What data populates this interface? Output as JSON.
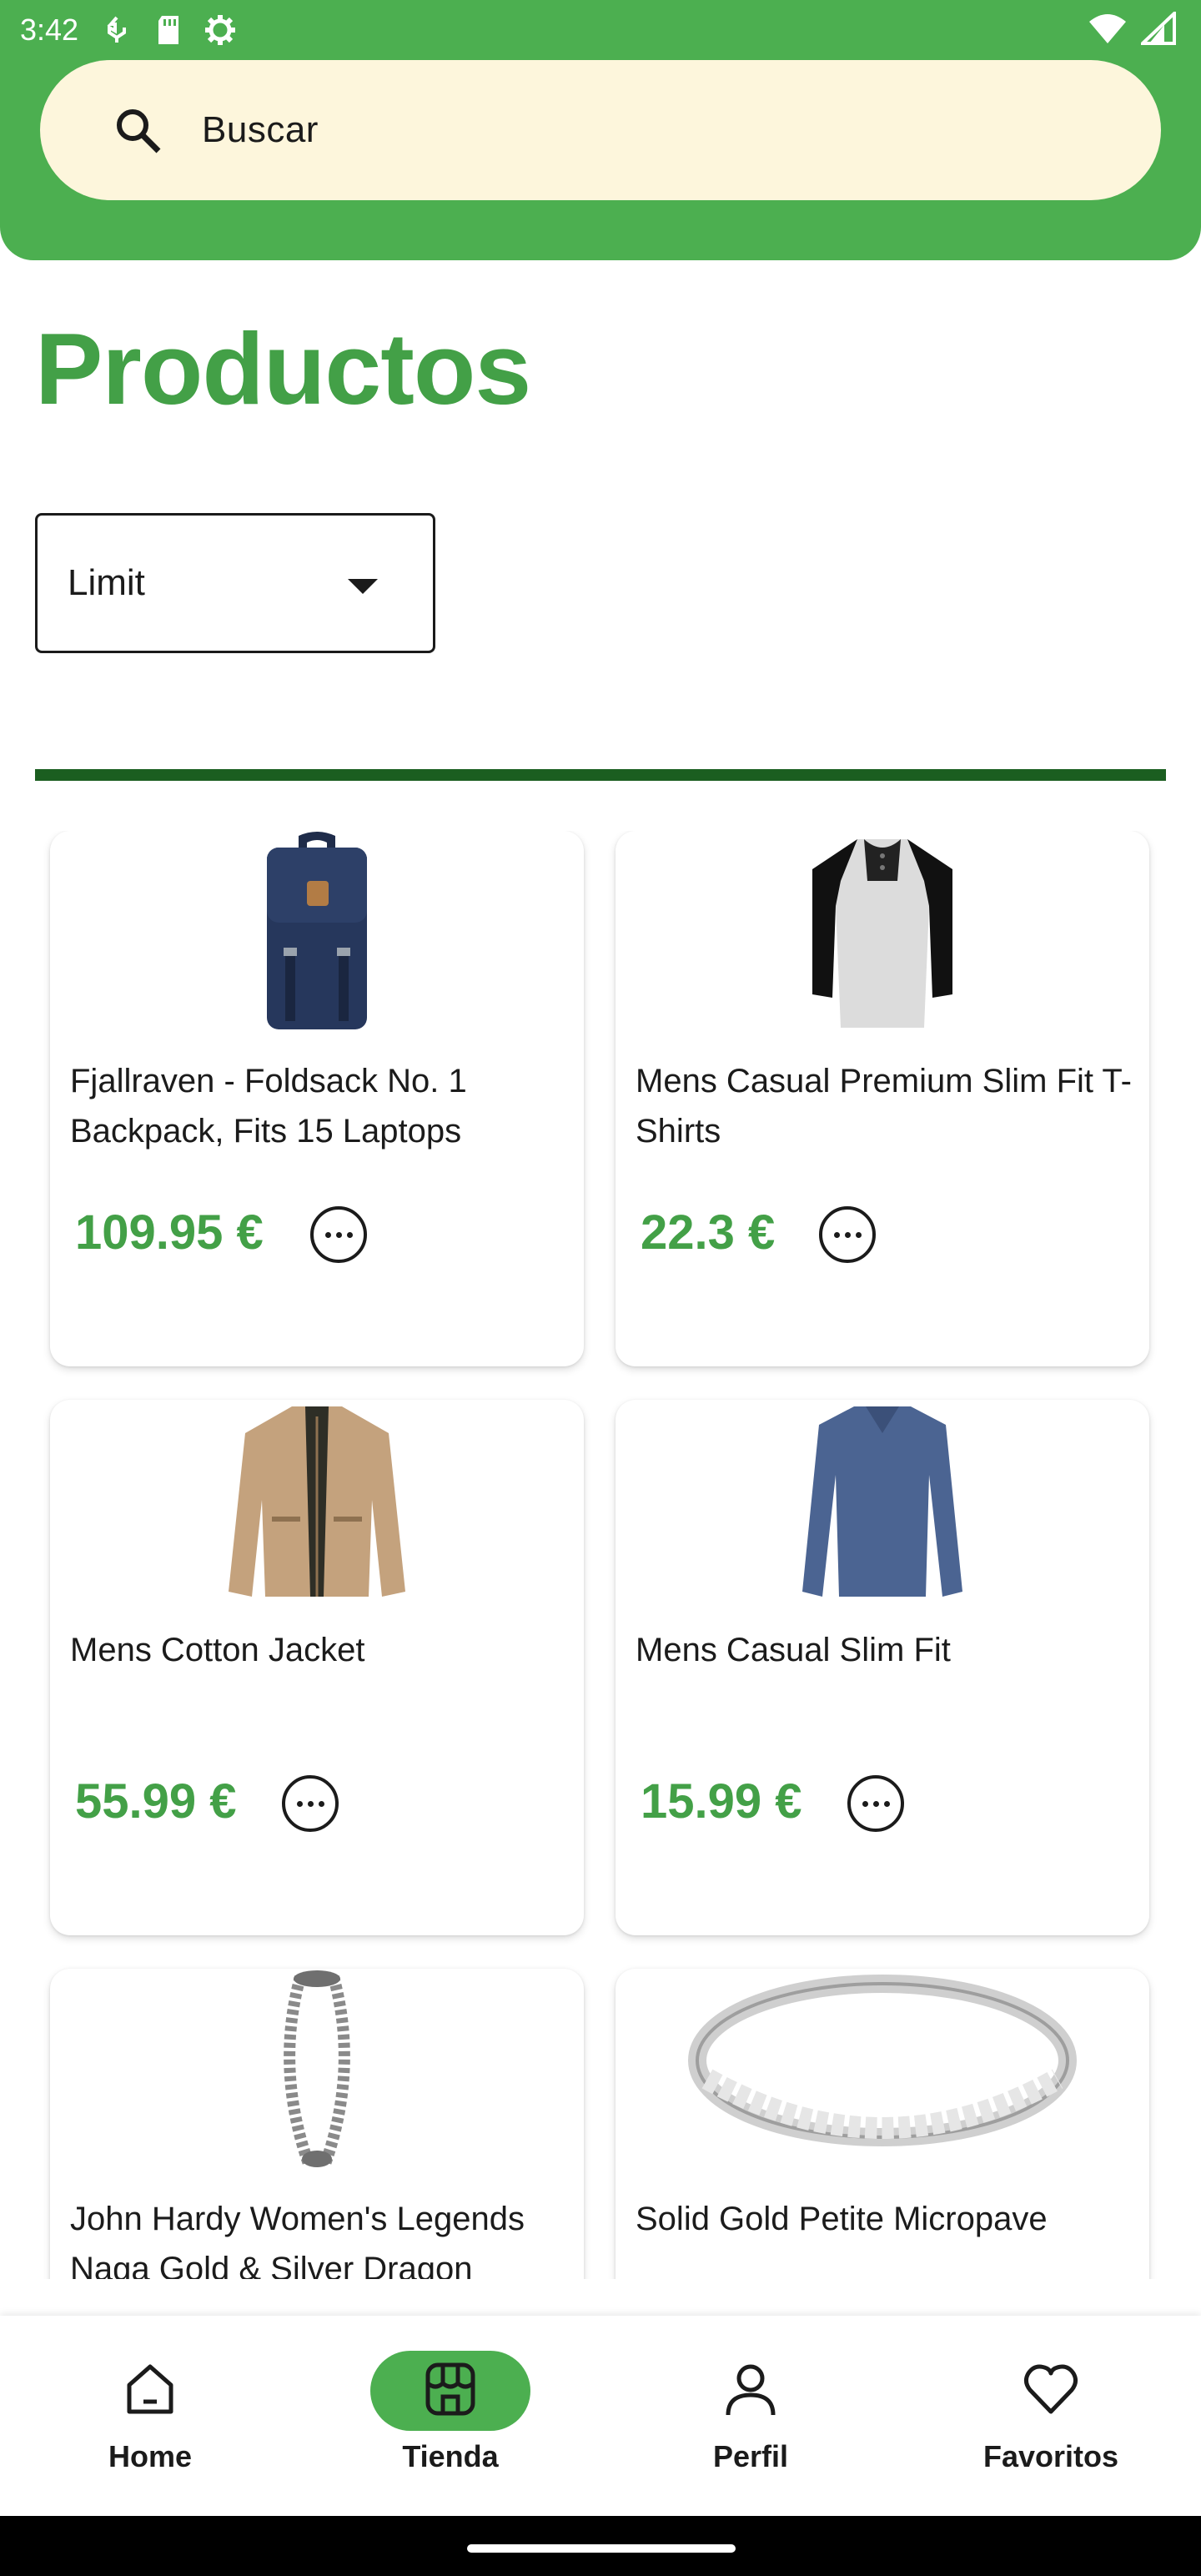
{
  "status_bar": {
    "time": "3:42"
  },
  "search": {
    "placeholder": "Buscar"
  },
  "page": {
    "title": "Productos"
  },
  "filter": {
    "label": "Limit"
  },
  "colors": {
    "primary": "#4caf50",
    "price": "#43a047",
    "divider": "#1b5e20",
    "search_bg": "#fdf6dc"
  },
  "products": [
    {
      "name": "Fjallraven - Foldsack No. 1 Backpack, Fits 15 Laptops",
      "price": "109.95 €",
      "icon": "backpack-image"
    },
    {
      "name": "Mens Casual Premium Slim Fit T-Shirts",
      "price": "22.3 €",
      "icon": "tshirt-image"
    },
    {
      "name": "Mens Cotton Jacket",
      "price": "55.99 €",
      "icon": "jacket-image"
    },
    {
      "name": "Mens Casual Slim Fit",
      "price": "15.99 €",
      "icon": "longsleeve-image"
    },
    {
      "name": "John Hardy Women's Legends Naga Gold & Silver Dragon",
      "price": "",
      "icon": "bracelet-image"
    },
    {
      "name": "Solid Gold Petite Micropave",
      "price": "",
      "icon": "ring-image"
    }
  ],
  "nav": {
    "items": [
      {
        "label": "Home",
        "icon": "home-icon",
        "active": false
      },
      {
        "label": "Tienda",
        "icon": "store-icon",
        "active": true
      },
      {
        "label": "Perfil",
        "icon": "person-icon",
        "active": false
      },
      {
        "label": "Favoritos",
        "icon": "heart-icon",
        "active": false
      }
    ]
  }
}
